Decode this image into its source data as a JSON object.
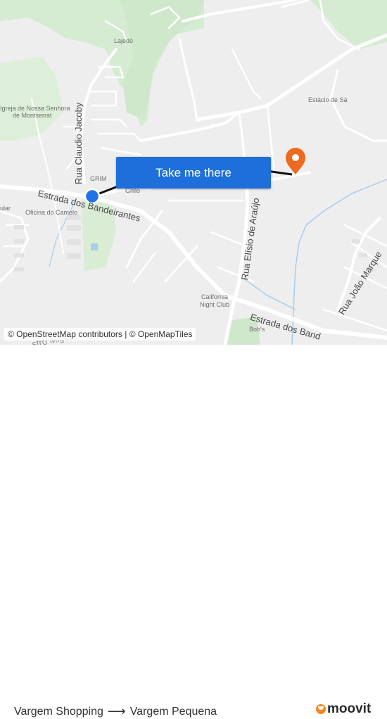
{
  "map": {
    "place_labels": {
      "lajedo": "Lajedo",
      "igreja": "Igreja de Nossa Senhora",
      "igreja2": "de Montserrat",
      "estacio": "Estácio de Sá",
      "grim": "GRIM",
      "grillo": "Grillo",
      "oficina": "Oficina do Camelo",
      "ular": "ular",
      "california": "California",
      "california2": "Night Club",
      "bobs": "Bob's"
    },
    "road_labels": {
      "claudio": "Rua Claudio Jacoby",
      "bandeirantes": "Estrada dos Bandeirantes",
      "elisio": "Rua Elísio de Araújo",
      "bandeirantes2": "Estrada dos Band",
      "joao": "Rua João Marque",
      "stro": "stro Miguel"
    },
    "colors": {
      "background": "#eeeeef",
      "green": "#d4ebd0",
      "road": "#ffffff",
      "water": "#a9cdeb",
      "route": "#111111",
      "origin": "#1e73e8",
      "destination": "#ee6a1f"
    }
  },
  "cta": {
    "label": "Take me there"
  },
  "attribution": "© OpenStreetMap contributors | © OpenMapTiles",
  "footer": {
    "origin": "Vargem Shopping",
    "destination": "Vargem Pequena",
    "arrow_icon": "arrow-right-icon"
  },
  "brand": {
    "name": "moovit",
    "color": "#f6861f"
  }
}
